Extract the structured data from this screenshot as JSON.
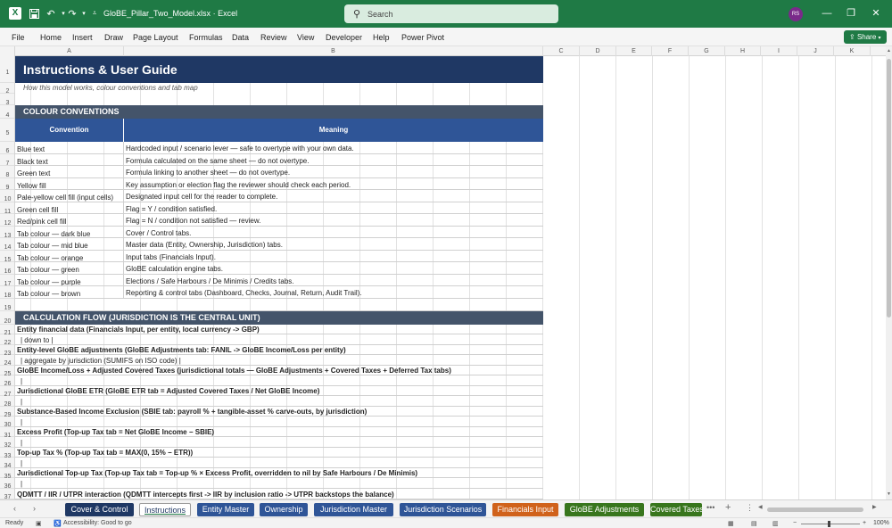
{
  "titlebar": {
    "filename": "GloBE_Pillar_Two_Model.xlsx",
    "separator": "·",
    "app": "Excel",
    "search_placeholder": "Search",
    "avatar_initials": "RS"
  },
  "menu": [
    "File",
    "Home",
    "Insert",
    "Draw",
    "Page Layout",
    "Formulas",
    "Data",
    "Review",
    "View",
    "Developer",
    "Help",
    "Power Pivot"
  ],
  "share_label": "Share",
  "columns": [
    "A",
    "B",
    "C",
    "D",
    "E",
    "F",
    "G",
    "H",
    "I",
    "J",
    "K"
  ],
  "rows": [
    "1",
    "2",
    "3",
    "4",
    "5",
    "6",
    "7",
    "8",
    "9",
    "10",
    "11",
    "12",
    "13",
    "14",
    "15",
    "16",
    "17",
    "18",
    "19",
    "20",
    "21",
    "22",
    "23",
    "24",
    "25",
    "26",
    "27",
    "28",
    "29",
    "30",
    "31",
    "32",
    "33",
    "34",
    "35",
    "36",
    "37"
  ],
  "sheet": {
    "title": "Instructions & User Guide",
    "subtitle": "How this model works, colour conventions and tab map",
    "section1": "COLOUR CONVENTIONS",
    "table_headers": [
      "Convention",
      "Meaning"
    ],
    "conventions": [
      {
        "convention": "Blue text",
        "meaning": "Hardcoded input / scenario lever — safe to overtype with your own data."
      },
      {
        "convention": "Black text",
        "meaning": "Formula calculated on the same sheet — do not overtype."
      },
      {
        "convention": "Green text",
        "meaning": "Formula linking to another sheet — do not overtype."
      },
      {
        "convention": "Yellow fill",
        "meaning": "Key assumption or election flag the reviewer should check each period."
      },
      {
        "convention": "Pale-yellow cell fill (input cells)",
        "meaning": "Designated input cell for the reader to complete."
      },
      {
        "convention": "Green cell fill",
        "meaning": "Flag = Y / condition satisfied."
      },
      {
        "convention": "Red/pink cell fill",
        "meaning": "Flag = N / condition not satisfied — review."
      },
      {
        "convention": "Tab colour — dark blue",
        "meaning": "Cover / Control tabs."
      },
      {
        "convention": "Tab colour — mid blue",
        "meaning": "Master data (Entity, Ownership, Jurisdiction) tabs."
      },
      {
        "convention": "Tab colour — orange",
        "meaning": "Input tabs (Financials Input)."
      },
      {
        "convention": "Tab colour — green",
        "meaning": "GloBE calculation engine tabs."
      },
      {
        "convention": "Tab colour — purple",
        "meaning": "Elections / Safe Harbours / De Minimis / Credits tabs."
      },
      {
        "convention": "Tab colour — brown",
        "meaning": "Reporting & control tabs (Dashboard, Checks, Journal, Return, Audit Trail)."
      }
    ],
    "section2": "CALCULATION FLOW (JURISDICTION IS THE CENTRAL UNIT)",
    "flow": [
      {
        "text": "Entity financial data  (Financials Input, per entity, local currency -> GBP)",
        "bold": true
      },
      {
        "text": "|  down to  |",
        "bold": false
      },
      {
        "text": "Entity-level GloBE adjustments  (GloBE Adjustments tab: FANIL -> GloBE Income/Loss per entity)",
        "bold": true
      },
      {
        "text": "|  aggregate by jurisdiction (SUMIFS on ISO code)  |",
        "bold": false
      },
      {
        "text": "GloBE Income/Loss + Adjusted Covered Taxes  (jurisdictional totals — GloBE Adjustments + Covered Taxes + Deferred Tax tabs)",
        "bold": true
      },
      {
        "text": "|",
        "bold": false
      },
      {
        "text": "Jurisdictional GloBE ETR  (GloBE ETR tab = Adjusted Covered Taxes / Net GloBE Income)",
        "bold": true
      },
      {
        "text": "|",
        "bold": false
      },
      {
        "text": "Substance-Based Income Exclusion  (SBIE tab: payroll % + tangible-asset % carve-outs, by jurisdiction)",
        "bold": true
      },
      {
        "text": "|",
        "bold": false
      },
      {
        "text": "Excess Profit  (Top-up Tax tab = Net GloBE Income − SBIE)",
        "bold": true
      },
      {
        "text": "|",
        "bold": false
      },
      {
        "text": "Top-up Tax %  (Top-up Tax tab = MAX(0, 15% − ETR))",
        "bold": true
      },
      {
        "text": "|",
        "bold": false
      },
      {
        "text": "Jurisdictional Top-up Tax  (Top-up Tax tab = Top-up % × Excess Profit, overridden to nil by Safe Harbours / De Minimis)",
        "bold": true
      },
      {
        "text": "|",
        "bold": false
      },
      {
        "text": "QDMTT / IIR / UTPR interaction  (QDMTT intercepts first -> IIR by inclusion ratio -> UTPR backstops the balance)",
        "bold": true
      }
    ]
  },
  "tabs": [
    {
      "label": "Cover & Control",
      "color": "#1f3864",
      "active": false
    },
    {
      "label": "Instructions",
      "color": "#1f3864",
      "active": true
    },
    {
      "label": "Entity Master",
      "color": "#2f5597",
      "active": false
    },
    {
      "label": "Ownership",
      "color": "#2f5597",
      "active": false
    },
    {
      "label": "Jurisdiction Master",
      "color": "#2f5597",
      "active": false
    },
    {
      "label": "Jurisdiction Scenarios",
      "color": "#2f5597",
      "active": false
    },
    {
      "label": "Financials Input",
      "color": "#d0621b",
      "active": false
    },
    {
      "label": "GloBE Adjustments",
      "color": "#38761d",
      "active": false
    },
    {
      "label": "Covered Taxes",
      "color": "#38761d",
      "active": false
    }
  ],
  "tab_controls": {
    "more": "•••",
    "add": "+",
    "options": "⋮"
  },
  "status": {
    "ready": "Ready",
    "accessibility": "Accessibility: Good to go",
    "zoom": "100%"
  }
}
